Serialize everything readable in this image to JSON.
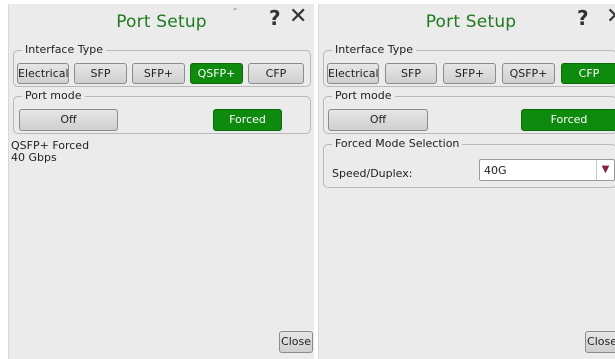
{
  "left": {
    "title": "Port Setup",
    "help": "?",
    "close_x": "✕",
    "interface_type": {
      "label": "Interface Type",
      "options": [
        "Electrical",
        "SFP",
        "SFP+",
        "QSFP+",
        "CFP"
      ],
      "selected": "QSFP+"
    },
    "port_mode": {
      "label": "Port mode",
      "off_label": "Off",
      "forced_label": "Forced",
      "selected": "Forced"
    },
    "status": {
      "line1": "QSFP+ Forced",
      "line2": "40 Gbps"
    },
    "close_button": "Close"
  },
  "right": {
    "title": "Port Setup",
    "help": "?",
    "close_x": "✕",
    "interface_type": {
      "label": "Interface Type",
      "options": [
        "Electrical",
        "SFP",
        "SFP+",
        "QSFP+",
        "CFP"
      ],
      "selected": "CFP"
    },
    "port_mode": {
      "label": "Port mode",
      "off_label": "Off",
      "forced_label": "Forced",
      "selected": "Forced"
    },
    "forced_mode": {
      "label": "Forced Mode Selection",
      "speed_label": "Speed/Duplex:",
      "speed_value": "40G"
    },
    "close_button": "Close"
  },
  "colors": {
    "accent_green": "#0e8a0e",
    "title_green": "#1f7a1f",
    "panel_bg": "#ebebeb"
  }
}
